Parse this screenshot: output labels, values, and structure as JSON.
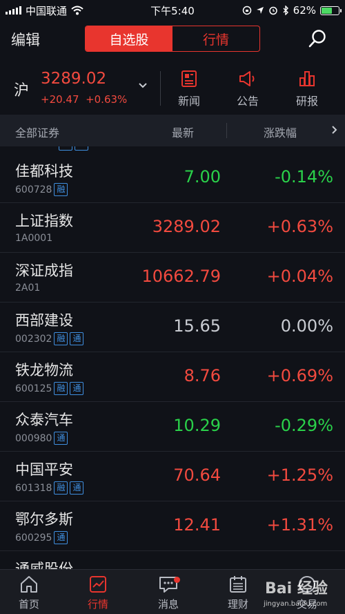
{
  "status_bar": {
    "carrier": "中国联通",
    "time": "下午5:40",
    "battery": "62%",
    "battery_level": 0.62
  },
  "header": {
    "edit_label": "编辑",
    "tabs": [
      "自选股",
      "行情"
    ]
  },
  "index": {
    "market": "沪",
    "value": "3289.02",
    "change": "+20.47",
    "change_pct": "+0.63%"
  },
  "shortcuts": [
    "新闻",
    "公告",
    "研报"
  ],
  "columns": {
    "name": "全部证券",
    "price": "最新",
    "change": "涨跌幅"
  },
  "rows": [
    {
      "name": "佳都科技",
      "code": "600728",
      "tags": [
        "融"
      ],
      "price": "7.00",
      "pct": "-0.14%",
      "trend": "down"
    },
    {
      "name": "上证指数",
      "code": "1A0001",
      "tags": [],
      "price": "3289.02",
      "pct": "+0.63%",
      "trend": "up"
    },
    {
      "name": "深证成指",
      "code": "2A01",
      "tags": [],
      "price": "10662.79",
      "pct": "+0.04%",
      "trend": "up"
    },
    {
      "name": "西部建设",
      "code": "002302",
      "tags": [
        "融",
        "通"
      ],
      "price": "15.65",
      "pct": "0.00%",
      "trend": "flat"
    },
    {
      "name": "铁龙物流",
      "code": "600125",
      "tags": [
        "融",
        "通"
      ],
      "price": "8.76",
      "pct": "+0.69%",
      "trend": "up"
    },
    {
      "name": "众泰汽车",
      "code": "000980",
      "tags": [
        "通"
      ],
      "price": "10.29",
      "pct": "-0.29%",
      "trend": "down"
    },
    {
      "name": "中国平安",
      "code": "601318",
      "tags": [
        "融",
        "通"
      ],
      "price": "70.64",
      "pct": "+1.25%",
      "trend": "up"
    },
    {
      "name": "鄂尔多斯",
      "code": "600295",
      "tags": [
        "通"
      ],
      "price": "12.41",
      "pct": "+1.31%",
      "trend": "up"
    },
    {
      "name": "通威股份",
      "code": "",
      "tags": [],
      "price": "",
      "pct": "",
      "trend": "flat"
    }
  ],
  "tabbar": [
    "首页",
    "行情",
    "消息",
    "理财",
    "交易"
  ],
  "watermark": {
    "brand": "Bai 经验",
    "url": "jingyan.baidu.com"
  },
  "colors": {
    "accent": "#e8352e",
    "up": "#f24a3f",
    "down": "#2ad14a",
    "tag": "#3f8fe0"
  }
}
